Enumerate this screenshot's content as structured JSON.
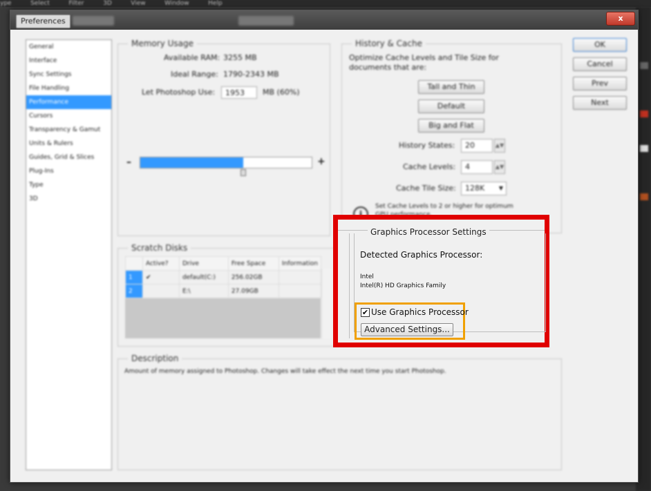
{
  "menubar": {
    "items": [
      "ype",
      "Select",
      "Filter",
      "3D",
      "View",
      "Window",
      "Help"
    ]
  },
  "window": {
    "tab_title": "Preferences",
    "close_symbol": "x"
  },
  "sidebar": {
    "items": [
      {
        "label": "General"
      },
      {
        "label": "Interface"
      },
      {
        "label": "Sync Settings"
      },
      {
        "label": "File Handling"
      },
      {
        "label": "Performance",
        "selected": true
      },
      {
        "label": "Cursors"
      },
      {
        "label": "Transparency & Gamut"
      },
      {
        "label": "Units & Rulers"
      },
      {
        "label": "Guides, Grid & Slices"
      },
      {
        "label": "Plug-Ins"
      },
      {
        "label": "Type"
      },
      {
        "label": "3D"
      }
    ]
  },
  "memory": {
    "title": "Memory Usage",
    "available_label": "Available RAM:",
    "available_value": "3255 MB",
    "ideal_label": "Ideal Range:",
    "ideal_value": "1790-2343 MB",
    "let_label": "Let Photoshop Use:",
    "let_value": "1953",
    "let_unit": "MB (60%)",
    "slider_fraction": 0.6,
    "minus": "–",
    "plus": "+"
  },
  "history": {
    "title": "History & Cache",
    "desc": "Optimize Cache Levels and Tile Size for documents that are:",
    "btn_tall": "Tall and Thin",
    "btn_default": "Default",
    "btn_big": "Big and Flat",
    "states_label": "History States:",
    "states_value": "20",
    "levels_label": "Cache Levels:",
    "levels_value": "4",
    "tile_label": "Cache Tile Size:",
    "tile_value": "128K",
    "info_text": "Set Cache Levels to 2 or higher for optimum GPU performance."
  },
  "scratch": {
    "title": "Scratch Disks",
    "headers": [
      "Active?",
      "Drive",
      "Free Space",
      "Information"
    ],
    "rows": [
      {
        "num": "1",
        "check": "✔",
        "drive": "default(C:)",
        "free": "256.02GB"
      },
      {
        "num": "2",
        "check": "",
        "drive": "E:\\",
        "free": "27.09GB"
      }
    ]
  },
  "description": {
    "title": "Description",
    "text": "Amount of memory assigned to Photoshop. Changes will take effect the next time you start Photoshop."
  },
  "gpu": {
    "title": "Graphics Processor Settings",
    "detected_label": "Detected Graphics Processor:",
    "vendor": "Intel",
    "model": "Intel(R) HD Graphics Family",
    "use_label": "Use Graphics Processor",
    "use_checked": "✔",
    "advanced_label": "Advanced Settings..."
  },
  "buttons": {
    "ok": "OK",
    "cancel": "Cancel",
    "prev": "Prev",
    "next": "Next"
  },
  "colors": {
    "selection": "#3399ff",
    "highlight_red": "#e00000",
    "highlight_orange": "#f0a000"
  }
}
